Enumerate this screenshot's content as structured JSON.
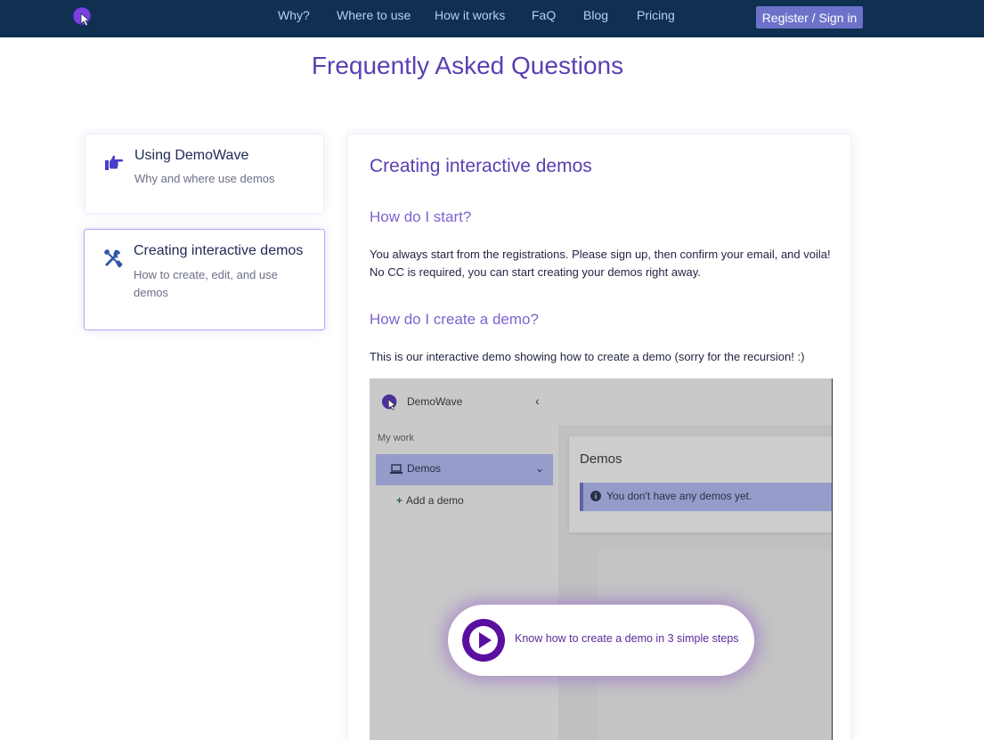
{
  "nav": {
    "logo_icon": "demowave-logo-icon",
    "links": [
      {
        "label": "Why?"
      },
      {
        "label": "Where to use"
      },
      {
        "label": "How it works"
      },
      {
        "label": "FaQ"
      },
      {
        "label": "Blog"
      },
      {
        "label": "Pricing"
      }
    ],
    "register_label": "Register / Sign in"
  },
  "page": {
    "title": "Frequently Asked Questions"
  },
  "sidebar": {
    "cards": [
      {
        "icon": "pointing-hand-icon",
        "title": "Using DemoWave",
        "description": "Why and where use demos"
      },
      {
        "icon": "tools-icon",
        "title": "Creating interactive demos",
        "description": "How to create, edit, and use demos"
      }
    ]
  },
  "main": {
    "section_title": "Creating interactive demos",
    "questions": [
      {
        "question": "How do I start?",
        "answer": "You always start from the registrations. Please sign up, then confirm your email, and voila! No CC is required, you can start creating your demos right away."
      },
      {
        "question": "How do I create a demo?",
        "answer": "This is our interactive demo showing how to create a demo (sorry for the recursion! :)"
      }
    ]
  },
  "demo": {
    "brand": "DemoWave",
    "collapse_icon": "chevron-left-icon",
    "section_label": "My work",
    "nav_item": {
      "icon": "laptop-icon",
      "label": "Demos",
      "chevron": "chevron-down-icon"
    },
    "add_label": "Add a demo",
    "card_title": "Demos",
    "alert_icon": "info-icon",
    "alert_text": "You don't have any demos yet.",
    "cta_icon": "play-icon",
    "cta_text": "Know how to create a demo in 3 simple steps"
  },
  "colors": {
    "navbar_bg": "#0f3050",
    "accent": "#5a3fb2",
    "button_bg": "#6c72c9",
    "cta_play": "#5a0fa0"
  }
}
